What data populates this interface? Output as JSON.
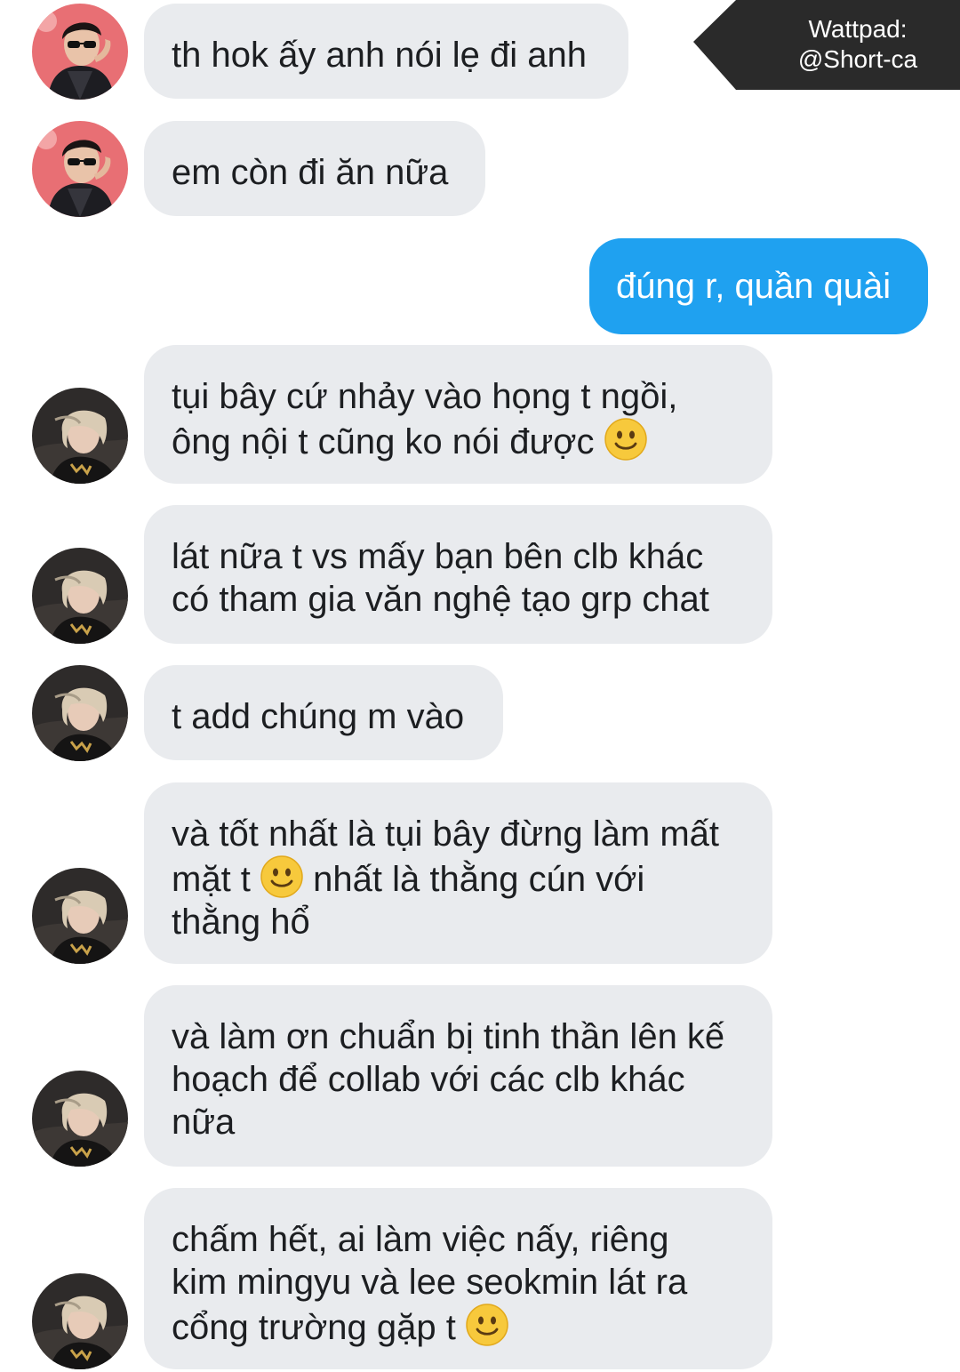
{
  "watermark": {
    "line1": "Wattpad:",
    "line2": "@Short-ca"
  },
  "colors": {
    "incoming_bubble": "#e9ebee",
    "outgoing_bubble": "#1fa1f0",
    "watermark_bg": "#2a2a2a"
  },
  "messages": [
    {
      "sender": "user-a",
      "direction": "incoming",
      "avatar_icon": "user-a-avatar-icon",
      "lines": [
        "th hok ấy anh nói lẹ đi anh"
      ]
    },
    {
      "sender": "user-a",
      "direction": "incoming",
      "avatar_icon": "user-a-avatar-icon",
      "lines": [
        "em còn đi ăn nữa"
      ]
    },
    {
      "sender": "me",
      "direction": "outgoing",
      "lines": [
        "đúng r, quần quài"
      ]
    },
    {
      "sender": "user-b",
      "direction": "incoming",
      "avatar_icon": "user-b-avatar-icon",
      "lines": [
        "tụi bây cứ nhảy vào họng t ngồi,",
        "ông nội t cũng ko nói được"
      ],
      "emoji": "slightly-smiling-face-icon"
    },
    {
      "sender": "user-b",
      "direction": "incoming",
      "avatar_icon": "user-b-avatar-icon",
      "lines": [
        "lát nữa t vs mấy bạn bên clb khác",
        "có tham gia văn nghệ tạo grp chat"
      ]
    },
    {
      "sender": "user-b",
      "direction": "incoming",
      "avatar_icon": "user-b-avatar-icon",
      "lines": [
        "t add chúng m vào"
      ]
    },
    {
      "sender": "user-b",
      "direction": "incoming",
      "avatar_icon": "user-b-avatar-icon",
      "lines": [
        "và tốt nhất là tụi bây đừng làm mất",
        "mặt t",
        "nhất là thằng cún với",
        "thằng hổ"
      ],
      "emoji": "slightly-smiling-face-icon"
    },
    {
      "sender": "user-b",
      "direction": "incoming",
      "avatar_icon": "user-b-avatar-icon",
      "lines": [
        "và làm ơn chuẩn bị tinh thần lên kế",
        "hoạch để collab với các clb khác",
        "nữa"
      ]
    },
    {
      "sender": "user-b",
      "direction": "incoming",
      "avatar_icon": "user-b-avatar-icon",
      "lines": [
        "chấm hết, ai làm việc nấy, riêng",
        "kim mingyu và lee seokmin lát ra",
        "cổng trường gặp t"
      ],
      "emoji": "slightly-smiling-face-icon"
    }
  ]
}
